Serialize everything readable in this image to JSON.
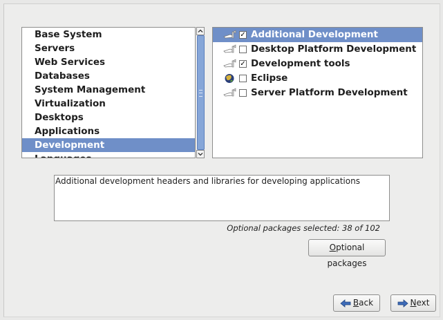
{
  "categories": {
    "items": [
      {
        "label": "Base System"
      },
      {
        "label": "Servers"
      },
      {
        "label": "Web Services"
      },
      {
        "label": "Databases"
      },
      {
        "label": "System Management"
      },
      {
        "label": "Virtualization"
      },
      {
        "label": "Desktops"
      },
      {
        "label": "Applications"
      },
      {
        "label": "Development"
      },
      {
        "label": "Languages"
      }
    ],
    "selected": "Development"
  },
  "packages": {
    "items": [
      {
        "label": "Additional Development",
        "checked": true,
        "icon": "dev-tools-icon",
        "selected": true
      },
      {
        "label": "Desktop Platform Development",
        "checked": false,
        "icon": "dev-tools-icon",
        "selected": false
      },
      {
        "label": "Development tools",
        "checked": true,
        "icon": "dev-tools-icon",
        "selected": false
      },
      {
        "label": "Eclipse",
        "checked": false,
        "icon": "eclipse-globe-icon",
        "selected": false
      },
      {
        "label": "Server Platform Development",
        "checked": false,
        "icon": "dev-tools-icon",
        "selected": false
      }
    ]
  },
  "description": "Additional development headers and libraries for developing applications",
  "status": "Optional packages selected: 38 of 102",
  "buttons": {
    "optional_packages_first": "O",
    "optional_packages_rest": "ptional packages",
    "back_first": "B",
    "back_rest": "ack",
    "next_first": "N",
    "next_rest": "ext"
  },
  "colors": {
    "selection": "#6f8fc8",
    "background": "#ededec"
  }
}
